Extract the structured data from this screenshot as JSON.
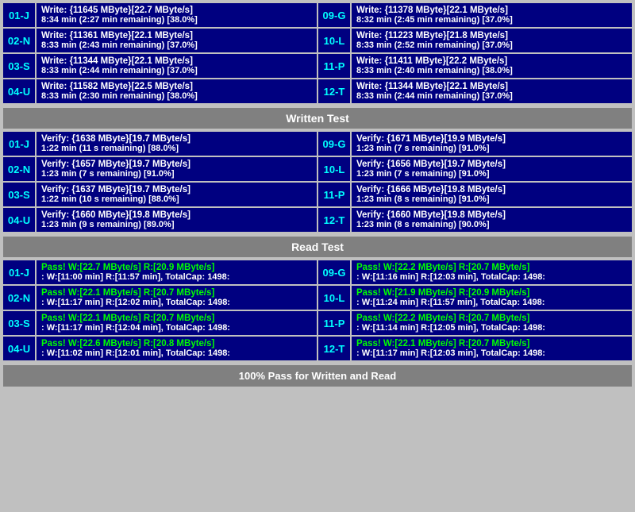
{
  "write_section": {
    "rows_left": [
      {
        "id": "01-J",
        "line1": "Write: {11645 MByte}[22.7 MByte/s]",
        "line2": "8:34 min (2:27 min remaining)  [38.0%]"
      },
      {
        "id": "02-N",
        "line1": "Write: {11361 MByte}[22.1 MByte/s]",
        "line2": "8:33 min (2:43 min remaining)  [37.0%]"
      },
      {
        "id": "03-S",
        "line1": "Write: {11344 MByte}[22.1 MByte/s]",
        "line2": "8:33 min (2:44 min remaining)  [37.0%]"
      },
      {
        "id": "04-U",
        "line1": "Write: {11582 MByte}[22.5 MByte/s]",
        "line2": "8:33 min (2:30 min remaining)  [38.0%]"
      }
    ],
    "rows_right": [
      {
        "id": "09-G",
        "line1": "Write: {11378 MByte}[22.1 MByte/s]",
        "line2": "8:32 min (2:45 min remaining)  [37.0%]"
      },
      {
        "id": "10-L",
        "line1": "Write: {11223 MByte}[21.8 MByte/s]",
        "line2": "8:33 min (2:52 min remaining)  [37.0%]"
      },
      {
        "id": "11-P",
        "line1": "Write: {11411 MByte}[22.2 MByte/s]",
        "line2": "8:33 min (2:40 min remaining)  [38.0%]"
      },
      {
        "id": "12-T",
        "line1": "Write: {11344 MByte}[22.1 MByte/s]",
        "line2": "8:33 min (2:44 min remaining)  [37.0%]"
      }
    ],
    "header": "Written Test"
  },
  "verify_section": {
    "rows_left": [
      {
        "id": "01-J",
        "line1": "Verify: {1638 MByte}[19.7 MByte/s]",
        "line2": "1:22 min (11 s remaining)   [88.0%]"
      },
      {
        "id": "02-N",
        "line1": "Verify: {1657 MByte}[19.7 MByte/s]",
        "line2": "1:23 min (7 s remaining)   [91.0%]"
      },
      {
        "id": "03-S",
        "line1": "Verify: {1637 MByte}[19.7 MByte/s]",
        "line2": "1:22 min (10 s remaining)   [88.0%]"
      },
      {
        "id": "04-U",
        "line1": "Verify: {1660 MByte}[19.8 MByte/s]",
        "line2": "1:23 min (9 s remaining)   [89.0%]"
      }
    ],
    "rows_right": [
      {
        "id": "09-G",
        "line1": "Verify: {1671 MByte}[19.9 MByte/s]",
        "line2": "1:23 min (7 s remaining)   [91.0%]"
      },
      {
        "id": "10-L",
        "line1": "Verify: {1656 MByte}[19.7 MByte/s]",
        "line2": "1:23 min (7 s remaining)   [91.0%]"
      },
      {
        "id": "11-P",
        "line1": "Verify: {1666 MByte}[19.8 MByte/s]",
        "line2": "1:23 min (8 s remaining)   [91.0%]"
      },
      {
        "id": "12-T",
        "line1": "Verify: {1660 MByte}[19.8 MByte/s]",
        "line2": "1:23 min (8 s remaining)   [90.0%]"
      }
    ],
    "header": "Read Test"
  },
  "pass_section": {
    "rows_left": [
      {
        "id": "01-J",
        "line1": "Pass! W:[22.7 MByte/s] R:[20.9 MByte/s]",
        "line2": ": W:[11:00 min] R:[11:57 min], TotalCap: 1498:"
      },
      {
        "id": "02-N",
        "line1": "Pass! W:[22.1 MByte/s] R:[20.7 MByte/s]",
        "line2": ": W:[11:17 min] R:[12:02 min], TotalCap: 1498:"
      },
      {
        "id": "03-S",
        "line1": "Pass! W:[22.1 MByte/s] R:[20.7 MByte/s]",
        "line2": ": W:[11:17 min] R:[12:04 min], TotalCap: 1498:"
      },
      {
        "id": "04-U",
        "line1": "Pass! W:[22.6 MByte/s] R:[20.8 MByte/s]",
        "line2": ": W:[11:02 min] R:[12:01 min], TotalCap: 1498:"
      }
    ],
    "rows_right": [
      {
        "id": "09-G",
        "line1": "Pass! W:[22.2 MByte/s] R:[20.7 MByte/s]",
        "line2": ": W:[11:16 min] R:[12:03 min], TotalCap: 1498:"
      },
      {
        "id": "10-L",
        "line1": "Pass! W:[21.9 MByte/s] R:[20.9 MByte/s]",
        "line2": ": W:[11:24 min] R:[11:57 min], TotalCap: 1498:"
      },
      {
        "id": "11-P",
        "line1": "Pass! W:[22.2 MByte/s] R:[20.7 MByte/s]",
        "line2": ": W:[11:14 min] R:[12:05 min], TotalCap: 1498:"
      },
      {
        "id": "12-T",
        "line1": "Pass! W:[22.1 MByte/s] R:[20.7 MByte/s]",
        "line2": ": W:[11:17 min] R:[12:03 min], TotalCap: 1498:"
      }
    ]
  },
  "bottom_status": "100% Pass for Written and Read"
}
